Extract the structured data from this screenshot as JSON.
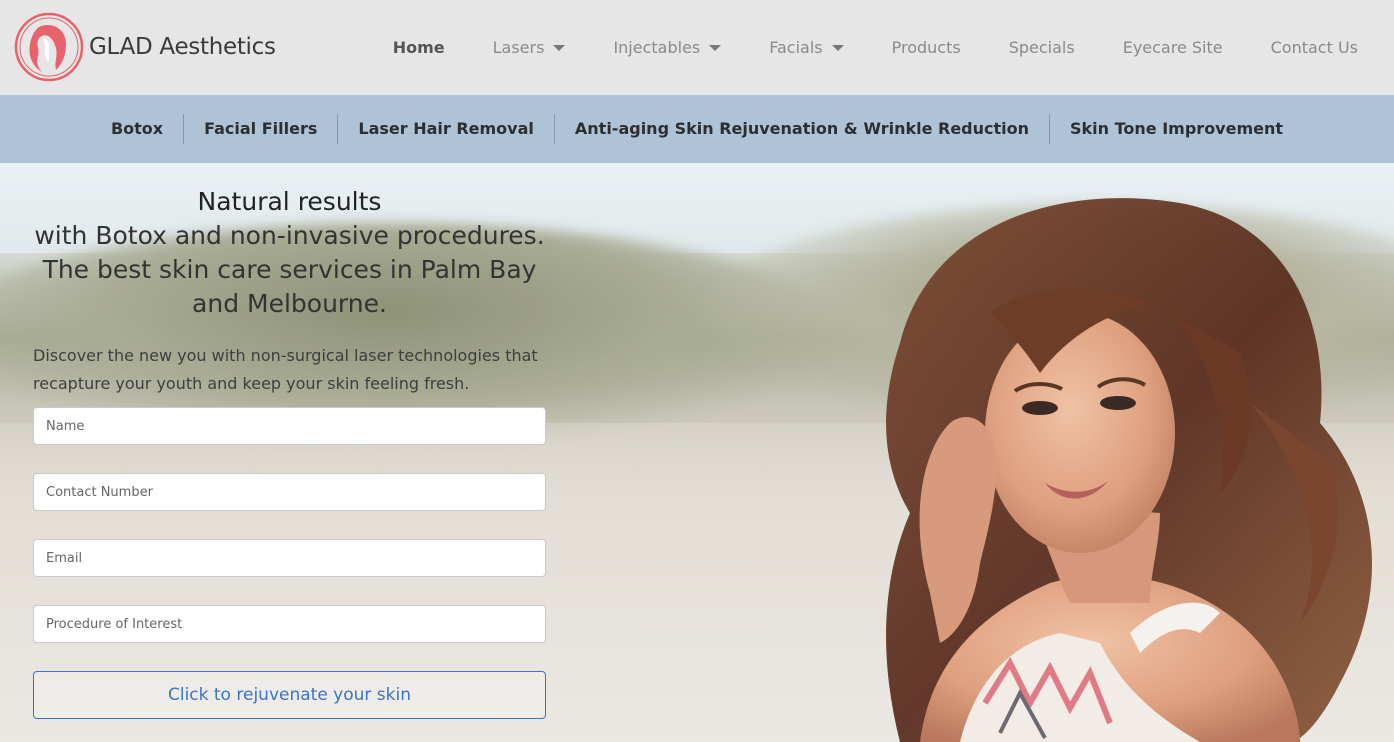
{
  "brand": {
    "name": "GLAD Aesthetics",
    "accent": "#e8626b"
  },
  "nav": {
    "items": [
      {
        "label": "Home",
        "dropdown": false,
        "active": true
      },
      {
        "label": "Lasers",
        "dropdown": true,
        "active": false
      },
      {
        "label": "Injectables",
        "dropdown": true,
        "active": false
      },
      {
        "label": "Facials",
        "dropdown": true,
        "active": false
      },
      {
        "label": "Products",
        "dropdown": false,
        "active": false
      },
      {
        "label": "Specials",
        "dropdown": false,
        "active": false
      },
      {
        "label": "Eyecare Site",
        "dropdown": false,
        "active": false
      },
      {
        "label": "Contact Us",
        "dropdown": false,
        "active": false
      }
    ]
  },
  "subnav": {
    "items": [
      {
        "label": "Botox"
      },
      {
        "label": "Facial Fillers"
      },
      {
        "label": "Laser Hair Removal"
      },
      {
        "label": "Anti-aging Skin Rejuvenation & Wrinkle Reduction"
      },
      {
        "label": "Skin Tone Improvement"
      }
    ]
  },
  "hero": {
    "headline": "Natural results",
    "subheadline": "with Botox and non-invasive procedures. The best skin care services in Palm Bay and Melbourne.",
    "description": "Discover the new you with non-surgical laser technologies that recapture your youth and keep your skin feeling fresh."
  },
  "form": {
    "name_placeholder": "Name",
    "contact_placeholder": "Contact Number",
    "email_placeholder": "Email",
    "procedure_placeholder": "Procedure of Interest",
    "submit_label": "Click to rejuvenate your skin"
  }
}
